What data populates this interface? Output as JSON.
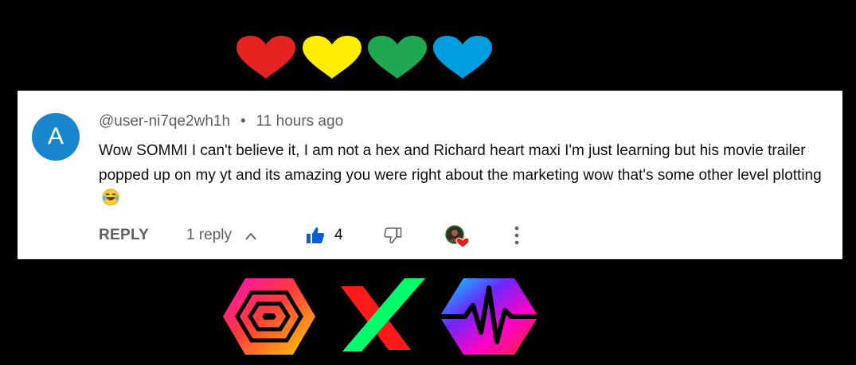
{
  "hearts": [
    {
      "icon": "heart-icon",
      "color": "#e52421"
    },
    {
      "icon": "heart-icon",
      "color": "#ffed00"
    },
    {
      "icon": "heart-icon",
      "color": "#1fa84f"
    },
    {
      "icon": "heart-icon",
      "color": "#009de0"
    }
  ],
  "comment": {
    "avatar_letter": "A",
    "avatar_color": "#1a86d0",
    "author": "@user-ni7qe2wh1h",
    "separator": "•",
    "time": "11 hours ago",
    "text": "Wow SOMMI I can't believe it, I am not a hex and Richard heart maxi I'm just learning but his movie trailer popped up on my yt and its amazing you were right about the marketing wow that's some other level plotting",
    "emoji": "😂",
    "actions": {
      "reply_label": "REPLY",
      "replies_label": "1 reply",
      "like_count": "4",
      "like_color": "#065fd4"
    }
  },
  "logos": [
    {
      "name": "hex-logo",
      "icon": "hex-icon"
    },
    {
      "name": "x-logo",
      "icon": "x-icon"
    },
    {
      "name": "pulsechain-logo",
      "icon": "pulse-icon"
    }
  ]
}
